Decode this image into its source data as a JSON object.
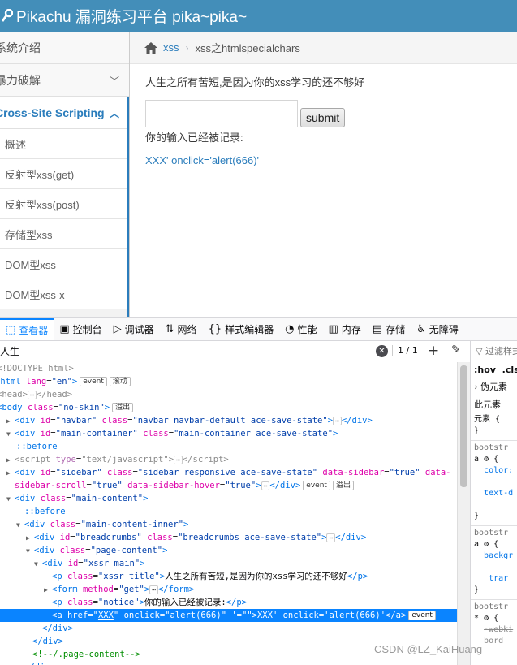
{
  "navbar": {
    "brand": "Pikachu 漏洞练习平台 pika~pika~"
  },
  "sidebar": {
    "items": [
      {
        "label": "系统介绍",
        "expandable": false
      },
      {
        "label": "暴力破解",
        "expandable": true
      },
      {
        "label": "Cross-Site Scripting",
        "expandable": true,
        "active": true
      }
    ],
    "subitems": [
      "概述",
      "反射型xss(get)",
      "反射型xss(post)",
      "存储型xss",
      "DOM型xss",
      "DOM型xss-x"
    ]
  },
  "breadcrumb": {
    "link": "xss",
    "current": "xss之htmlspecialchars"
  },
  "content": {
    "title": "人生之所有苦短,是因为你的xss学习的还不够好",
    "input_value": "",
    "submit": "submit",
    "notice": "你的输入已经被记录:",
    "result_link": "XXX' onclick='alert(666)'"
  },
  "devtools": {
    "tabs": [
      {
        "label": "查看器",
        "icon": "inspector-icon",
        "glyph": "⬚",
        "selected": true
      },
      {
        "label": "控制台",
        "icon": "console-icon",
        "glyph": "▣"
      },
      {
        "label": "调试器",
        "icon": "debugger-icon",
        "glyph": "▷"
      },
      {
        "label": "网络",
        "icon": "network-icon",
        "glyph": "⇅"
      },
      {
        "label": "样式编辑器",
        "icon": "style-editor-icon",
        "glyph": "{}"
      },
      {
        "label": "性能",
        "icon": "performance-icon",
        "glyph": "◔"
      },
      {
        "label": "内存",
        "icon": "memory-icon",
        "glyph": "▥"
      },
      {
        "label": "存储",
        "icon": "storage-icon",
        "glyph": "▤"
      },
      {
        "label": "无障碍",
        "icon": "accessibility-icon",
        "glyph": "♿"
      }
    ],
    "search": {
      "query": "人生",
      "count": "1 / 1"
    },
    "markup": {
      "doctype": "<!DOCTYPE html>",
      "html_open": "html",
      "html_lang": "en",
      "event": "event",
      "scroll": "滚动",
      "overflow": "溢出",
      "head": "head",
      "body_class": "no-skin",
      "navbar_id": "navbar",
      "navbar_class": "navbar navbar-default ace-save-state",
      "main_container_id": "main-container",
      "main_container_class": "main-container ace-save-state",
      "before": "::before",
      "script_type": "text/javascript",
      "sidebar_id": "sidebar",
      "sidebar_class": "sidebar responsive ace-save-state",
      "sidebar_attr1": "true",
      "sidebar_attr2": "true",
      "sidebar_attr3": "true",
      "main_content_class": "main-content",
      "main_content_inner_class": "main-content-inner",
      "breadcrumbs_id": "breadcrumbs",
      "breadcrumbs_class": "breadcrumbs ace-save-state",
      "page_content_class": "page-content",
      "xssr_main_id": "xssr_main",
      "xssr_title_class": "xssr_title",
      "xssr_title_text": "人生之所有苦短,是因为你的xss学习的还不够好",
      "form_method": "get",
      "notice_class": "notice",
      "notice_text": "你的输入已经被记录:",
      "a_href": "XXX",
      "a_onclick": "alert(666)",
      "a_extra": "'=\"\"",
      "a_text": "XXX' onclick='alert(666)'",
      "page_content_comment": "<!--/.page-content-->"
    },
    "rules": {
      "filter": "过滤样式",
      "hov": ":hov",
      "cls": ".cls",
      "pseudo": "伪元素",
      "this_element": "此元素",
      "element": "元素",
      "src": "bootstr",
      "sel_a": "a",
      "sel_star": "*",
      "prop_color": "color:",
      "prop_text": "text-d",
      "prop_bg": "backgr",
      "prop_tran": "trar",
      "prop_webkit": "-webki",
      "prop_bord": "bord"
    }
  },
  "watermark": "CSDN @LZ_KaiHuang"
}
